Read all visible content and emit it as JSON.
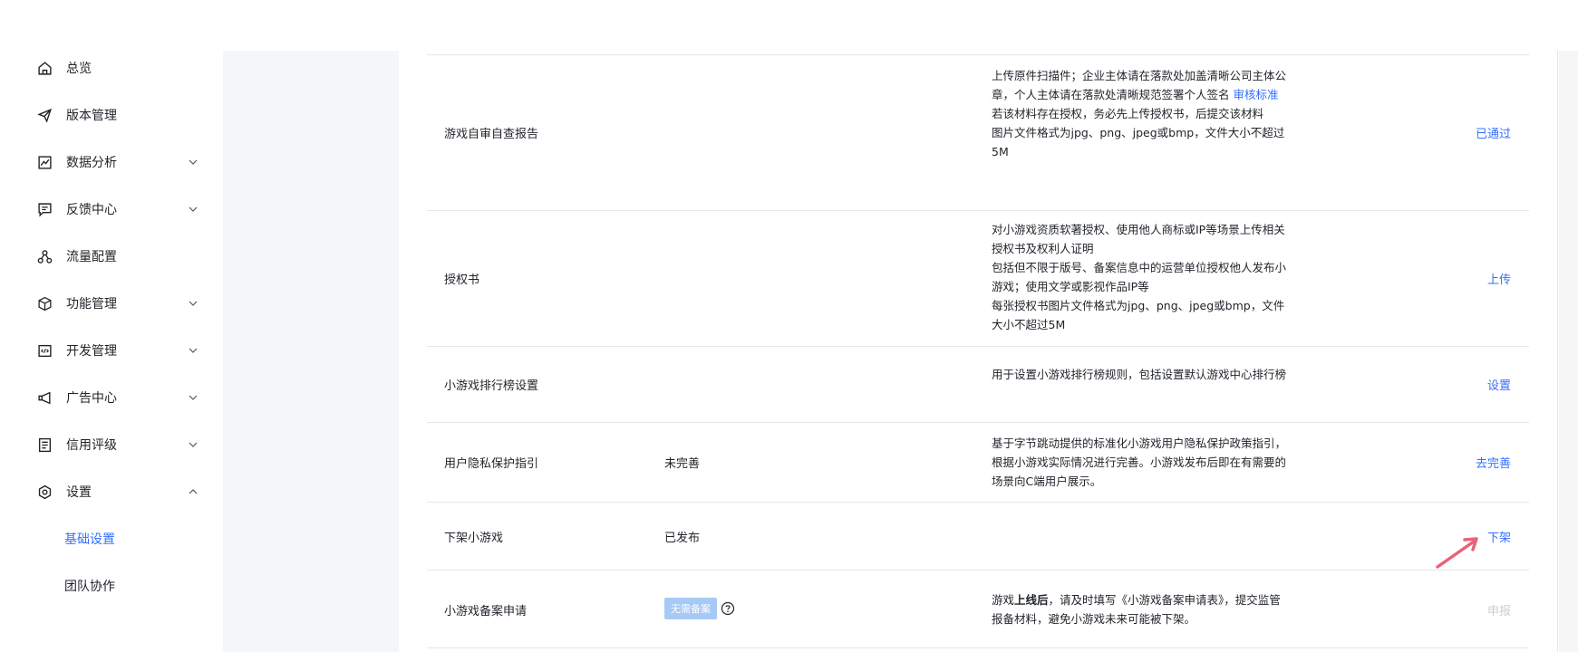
{
  "sidebar": {
    "items": [
      {
        "label": "总览",
        "icon": "home-icon"
      },
      {
        "label": "版本管理",
        "icon": "send-icon"
      },
      {
        "label": "数据分析",
        "icon": "chart-icon",
        "expandable": true
      },
      {
        "label": "反馈中心",
        "icon": "message-icon",
        "expandable": true
      },
      {
        "label": "流量配置",
        "icon": "share-icon"
      },
      {
        "label": "功能管理",
        "icon": "cube-icon",
        "expandable": true
      },
      {
        "label": "开发管理",
        "icon": "code-icon",
        "expandable": true
      },
      {
        "label": "广告中心",
        "icon": "megaphone-icon",
        "expandable": true
      },
      {
        "label": "信用评级",
        "icon": "document-icon",
        "expandable": true
      },
      {
        "label": "设置",
        "icon": "gear-icon",
        "expanded": true
      }
    ],
    "sub_items": [
      {
        "label": "基础设置",
        "active": true
      },
      {
        "label": "团队协作",
        "active": false
      }
    ]
  },
  "rows": [
    {
      "name": "游戏自审自查报告",
      "status": "",
      "desc": {
        "line1": "上传原件扫描件；企业主体请在落款处加盖清晰公司主体公章，个人主体请在落款处清晰规范签署个人签名",
        "link": "审核标准",
        "line2": "若该材料存在授权，务必先上传授权书，后提交该材料",
        "line3": "图片文件格式为jpg、png、jpeg或bmp，文件大小不超过5M"
      },
      "action": "已通过"
    },
    {
      "name": "授权书",
      "status": "",
      "desc": {
        "line1": "对小游戏资质软著授权、使用他人商标或IP等场景上传相关授权书及权利人证明",
        "line2": "包括但不限于版号、备案信息中的运营单位授权他人发布小游戏；使用文学或影视作品IP等",
        "line3": "每张授权书图片文件格式为jpg、png、jpeg或bmp，文件大小不超过5M"
      },
      "action": "上传"
    },
    {
      "name": "小游戏排行榜设置",
      "status": "",
      "desc": {
        "line1": "用于设置小游戏排行榜规则，包括设置默认游戏中心排行榜"
      },
      "action": "设置"
    },
    {
      "name": "用户隐私保护指引",
      "status": "未完善",
      "desc": {
        "line1": "基于字节跳动提供的标准化小游戏用户隐私保护政策指引，根据小游戏实际情况进行完善。小游戏发布后即在有需要的场景向C端用户展示。"
      },
      "action": "去完善"
    },
    {
      "name": "下架小游戏",
      "status": "已发布",
      "desc": {
        "line1": ""
      },
      "action": "下架"
    },
    {
      "name": "小游戏备案申请",
      "badge": "无需备案",
      "desc": {
        "pre": "游戏",
        "bold": "上线后",
        "post": "，请及时填写《小游戏备案申请表》，提交监管报备材料，避免小游戏未来可能被下架。"
      },
      "action": "申报"
    }
  ],
  "colors": {
    "accent": "#3370ff",
    "badge": "#a7c9f6",
    "arrow": "#e8627a",
    "disabled": "#c9cdd4"
  }
}
